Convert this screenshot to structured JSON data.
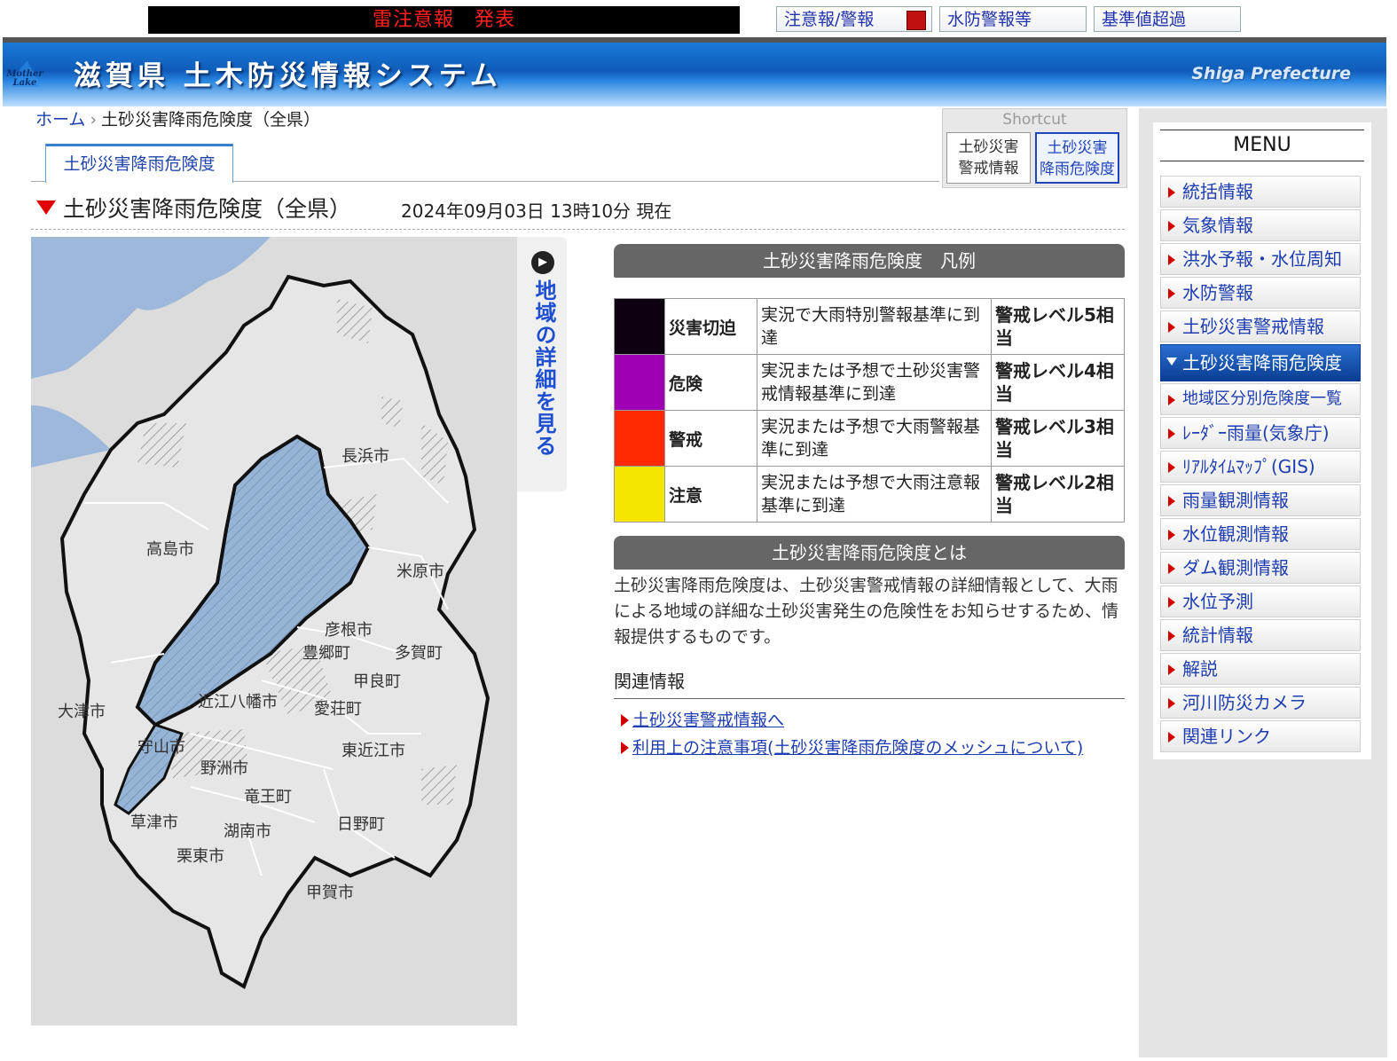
{
  "top_bar": {
    "alert": "雷注意報　発表",
    "buttons": [
      "注意報/警報",
      "水防警報等",
      "基準値超過"
    ]
  },
  "header": {
    "logo": "Mother Lake",
    "title": "滋賀県 土木防災情報システム",
    "right_text": "Shiga Prefecture"
  },
  "breadcrumb": {
    "home": "ホーム",
    "current": "土砂災害降雨危険度（全県）"
  },
  "tab": {
    "active": "土砂災害降雨危険度"
  },
  "shortcut": {
    "title": "Shortcut",
    "items": [
      {
        "line1": "土砂災害",
        "line2": "警戒情報"
      },
      {
        "line1": "土砂災害",
        "line2": "降雨危険度"
      }
    ]
  },
  "heading": {
    "title": "土砂災害降雨危険度（全県）",
    "datetime": "2024年09月03日 13時10分 現在"
  },
  "map": {
    "detail_button": "地域の詳細を見る",
    "labels": [
      "長浜市",
      "高島市",
      "米原市",
      "彦根市",
      "豊郷町",
      "多賀町",
      "甲良町",
      "近江八幡市",
      "愛荘町",
      "大津市",
      "守山市",
      "東近江市",
      "野洲市",
      "竜王町",
      "草津市",
      "湖南市",
      "日野町",
      "栗東市",
      "甲賀市"
    ]
  },
  "legend": {
    "title": "土砂災害降雨危険度　凡例",
    "rows": [
      {
        "color": "#0c0010",
        "name": "災害切迫",
        "desc": "実況で大雨特別警報基準に到達",
        "level": "警戒レベル5相当"
      },
      {
        "color": "#a000b4",
        "name": "危険",
        "desc": "実況または予想で土砂災害警戒情報基準に到達",
        "level": "警戒レベル4相当"
      },
      {
        "color": "#ff2800",
        "name": "警戒",
        "desc": "実況または予想で大雨警報基準に到達",
        "level": "警戒レベル3相当"
      },
      {
        "color": "#f5e600",
        "name": "注意",
        "desc": "実況または予想で大雨注意報基準に到達",
        "level": "警戒レベル2相当"
      }
    ]
  },
  "about": {
    "title": "土砂災害降雨危険度とは",
    "text": "土砂災害降雨危険度は、土砂災害警戒情報の詳細情報として、大雨による地域の詳細な土砂災害発生の危険性をお知らせするため、情報提供するものです。"
  },
  "related": {
    "title": "関連情報",
    "links": [
      "土砂災害警戒情報へ",
      "利用上の注意事項(土砂災害降雨危険度のメッシュについて)"
    ]
  },
  "menu": {
    "title": "MENU",
    "items": [
      "統括情報",
      "気象情報",
      "洪水予報・水位周知",
      "水防警報",
      "土砂災害警戒情報",
      "土砂災害降雨危険度",
      "地域区分別危険度一覧",
      "ﾚｰﾀﾞｰ雨量(気象庁)",
      "ﾘｱﾙﾀｲﾑﾏｯﾌﾟ(GIS)",
      "雨量観測情報",
      "水位観測情報",
      "ダム観測情報",
      "水位予測",
      "統計情報",
      "解説",
      "河川防災カメラ",
      "関連リンク"
    ],
    "active_index": 5
  }
}
